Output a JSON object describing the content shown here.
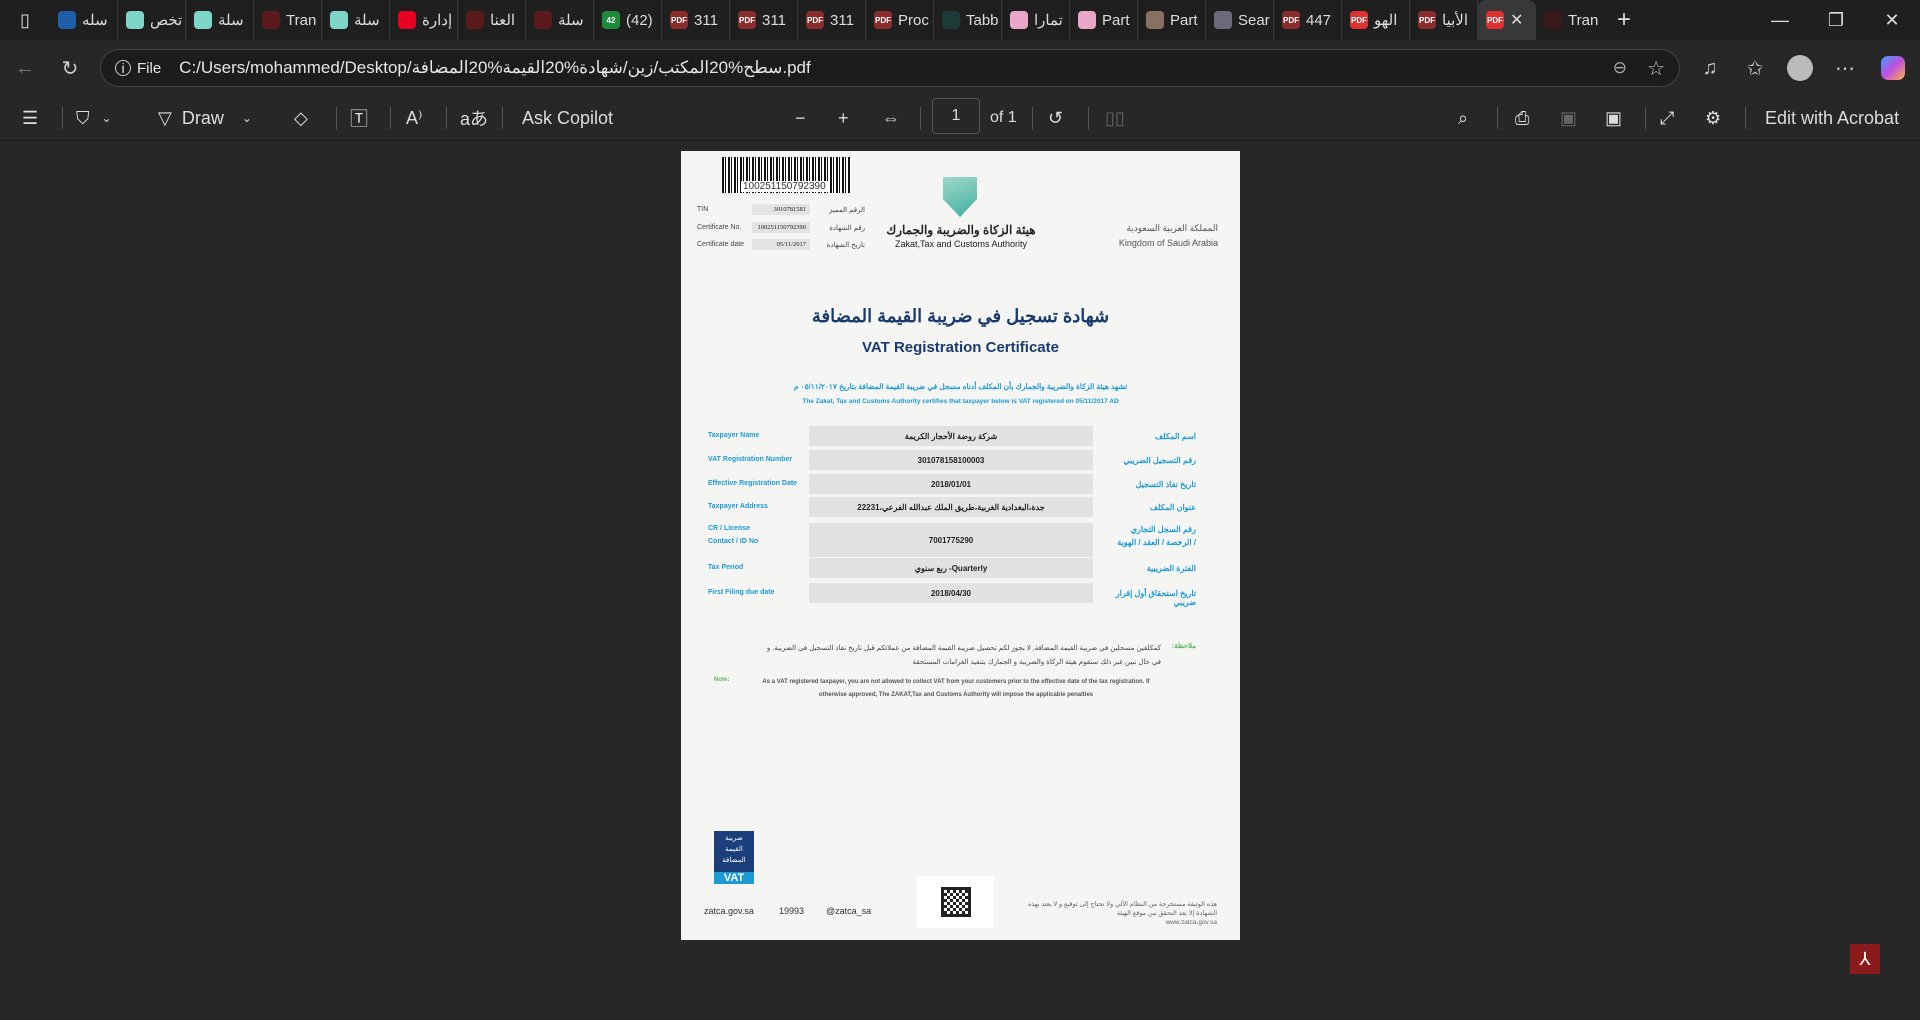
{
  "tabs": [
    {
      "label": "سله",
      "icon": "search-icon",
      "color": "#1d5fa8"
    },
    {
      "label": "تخص",
      "icon": "salla-icon",
      "color": "#7ed6c8"
    },
    {
      "label": "سلة",
      "icon": "salla-icon",
      "color": "#7ed6c8"
    },
    {
      "label": "Tran",
      "icon": "circle-icon",
      "color": "#5a1a1a"
    },
    {
      "label": "سلة",
      "icon": "salla-icon",
      "color": "#7ed6c8"
    },
    {
      "label": "إدارة",
      "icon": "youtube-icon",
      "color": "#e60023"
    },
    {
      "label": "العنا",
      "icon": "circle-icon",
      "color": "#5a1a1a"
    },
    {
      "label": "سلة",
      "icon": "circle-icon",
      "color": "#5a1a1a"
    },
    {
      "label": "(42)",
      "icon": "whatsapp-icon",
      "color": "#1e8a3c",
      "badge": "42"
    },
    {
      "label": "311",
      "icon": "pdf-icon",
      "color": "#8b2c2c"
    },
    {
      "label": "311",
      "icon": "pdf-icon",
      "color": "#8b2c2c"
    },
    {
      "label": "311",
      "icon": "pdf-icon",
      "color": "#8b2c2c"
    },
    {
      "label": "Proc",
      "icon": "pdf-icon",
      "color": "#8b2c2c"
    },
    {
      "label": "Tabb",
      "icon": "tabby-icon",
      "color": "#1c3a36"
    },
    {
      "label": "تمارا",
      "icon": "tamara-icon",
      "color": "#e9a6c9"
    },
    {
      "label": "Part",
      "icon": "tamara-icon",
      "color": "#e9a6c9"
    },
    {
      "label": "Part",
      "icon": "tamara-icon",
      "color": "#8a7060"
    },
    {
      "label": "Sear",
      "icon": "tamara-icon",
      "color": "#6a6a7a"
    },
    {
      "label": "447",
      "icon": "pdf-icon",
      "color": "#8b2c2c"
    },
    {
      "label": "الهو",
      "icon": "pdf-icon",
      "color": "#e03030"
    },
    {
      "label": "الأبيا",
      "icon": "pdf-icon",
      "color": "#8b2c2c"
    }
  ],
  "active_tab": {
    "icon": "pdf-icon",
    "color": "#e03030"
  },
  "last_tab": {
    "label": "Tran"
  },
  "address": {
    "scheme": "File",
    "url": "C:/Users/mohammed/Desktop/سطح%20المكتب/زين/شهادة%20القيمة%20المضافة.pdf"
  },
  "toolbar": {
    "draw": "Draw",
    "ask_copilot": "Ask Copilot",
    "page_number": "1",
    "page_of": "of 1",
    "edit_acrobat": "Edit with Acrobat"
  },
  "doc": {
    "barcode": "100251150792390",
    "info": [
      {
        "en": "TIN",
        "value": "3010781581",
        "ar": "الرقم المميز"
      },
      {
        "en": "Certificate No.",
        "value": "100251150792390",
        "ar": "رقم الشهادة"
      },
      {
        "en": "Certificate date",
        "value": "05/11/2017",
        "ar": "تاريخ الشهادة"
      }
    ],
    "authority_ar": "هيئة الزكاة والضريبة والجمارك",
    "authority_en": "Zakat,Tax and Customs Authority",
    "kingdom_ar": "المملكة العربية السعودية",
    "kingdom_en": "Kingdom of Saudi Arabia",
    "title_ar": "شهادة تسجيل في ضريبة القيمة المضافة",
    "title_en": "VAT Registration Certificate",
    "certify_ar": "تشهد هيئة الزكاة والضريبة والجمارك بأن المكلف أدناه مسجل في ضريبة القيمة المضافة بتاريخ ٠٥/١١/٢٠١٧ م",
    "certify_en": "The Zakat, Tax and Customs Authority certifies that taxpayer below is VAT registered on 05/11/2017 AD",
    "rows": [
      {
        "en": "Taxpayer Name",
        "value": "شركة روضة الأحجار الكريمة",
        "ar": "اسم المكلف"
      },
      {
        "en": "VAT Registration Number",
        "value": "301078158100003",
        "ar": "رقم التسجيل الضريبي"
      },
      {
        "en": "Effective Registration Date",
        "value": "2018/01/01",
        "ar": "تاريخ نفاذ التسجيل"
      },
      {
        "en": "Taxpayer Address",
        "value": "جدة،البغدادية الغربية،طريق الملك عبدالله الفرعي،22231",
        "ar": "عنوان المكلف"
      },
      {
        "en": "CR / License",
        "en2": "Contact / ID No",
        "value": "7001775290",
        "ar": "رقم السجل التجاري",
        "ar2": "/ الرخصة / العقد / الهوية"
      },
      {
        "en": "Tax Period",
        "value": "Quarterly- ربع سنوي",
        "ar": "الفترة الضريبية"
      },
      {
        "en": "First Filing due date",
        "value": "2018/04/30",
        "ar": "تاريخ استحقاق أول إقرار ضريبي"
      }
    ],
    "note_label_ar": "ملاحظة:",
    "note_ar": "كمكلفين مسجلين في ضريبة القيمة المضافة, لا يجوز لكم تحصيل ضريبة القيمة المضافة من عملائكم قبل تاريخ نفاذ التسجيل في الضريبة. و في حال تبين غير ذلك ستقوم هيئة الزكاة والضريبة و الجمارك بتنفيذ الغرامات المستحقة",
    "note_label_en": "Note:",
    "note_en": "As a VAT registered taxpayer, you are not allowed to collect VAT from your customers prior to the effective date of the tax registration. If otherwise approved, The ZAKAT,Tax and Customs Authority will impose the applicable penalties",
    "vat_logo_ar": "ضريبة القيمة المضافة",
    "vat_logo_en": "VAT",
    "footer": {
      "site": "zatca.gov.sa",
      "phone": "19993",
      "handle": "@zatca_sa",
      "disclaimer": "هذه الوثيقة مستخرجة من النظام الآلي ولا تحتاج إلى توقيع و لا يعتد بهذه الشهادة إلا بعد التحقق من موقع الهيئة",
      "disclaimer_url": "www.zatca.gov.sa"
    }
  },
  "colors": {
    "accent": "#1d9ad6",
    "title": "#1a3b6e",
    "note": "#5cb85c"
  }
}
